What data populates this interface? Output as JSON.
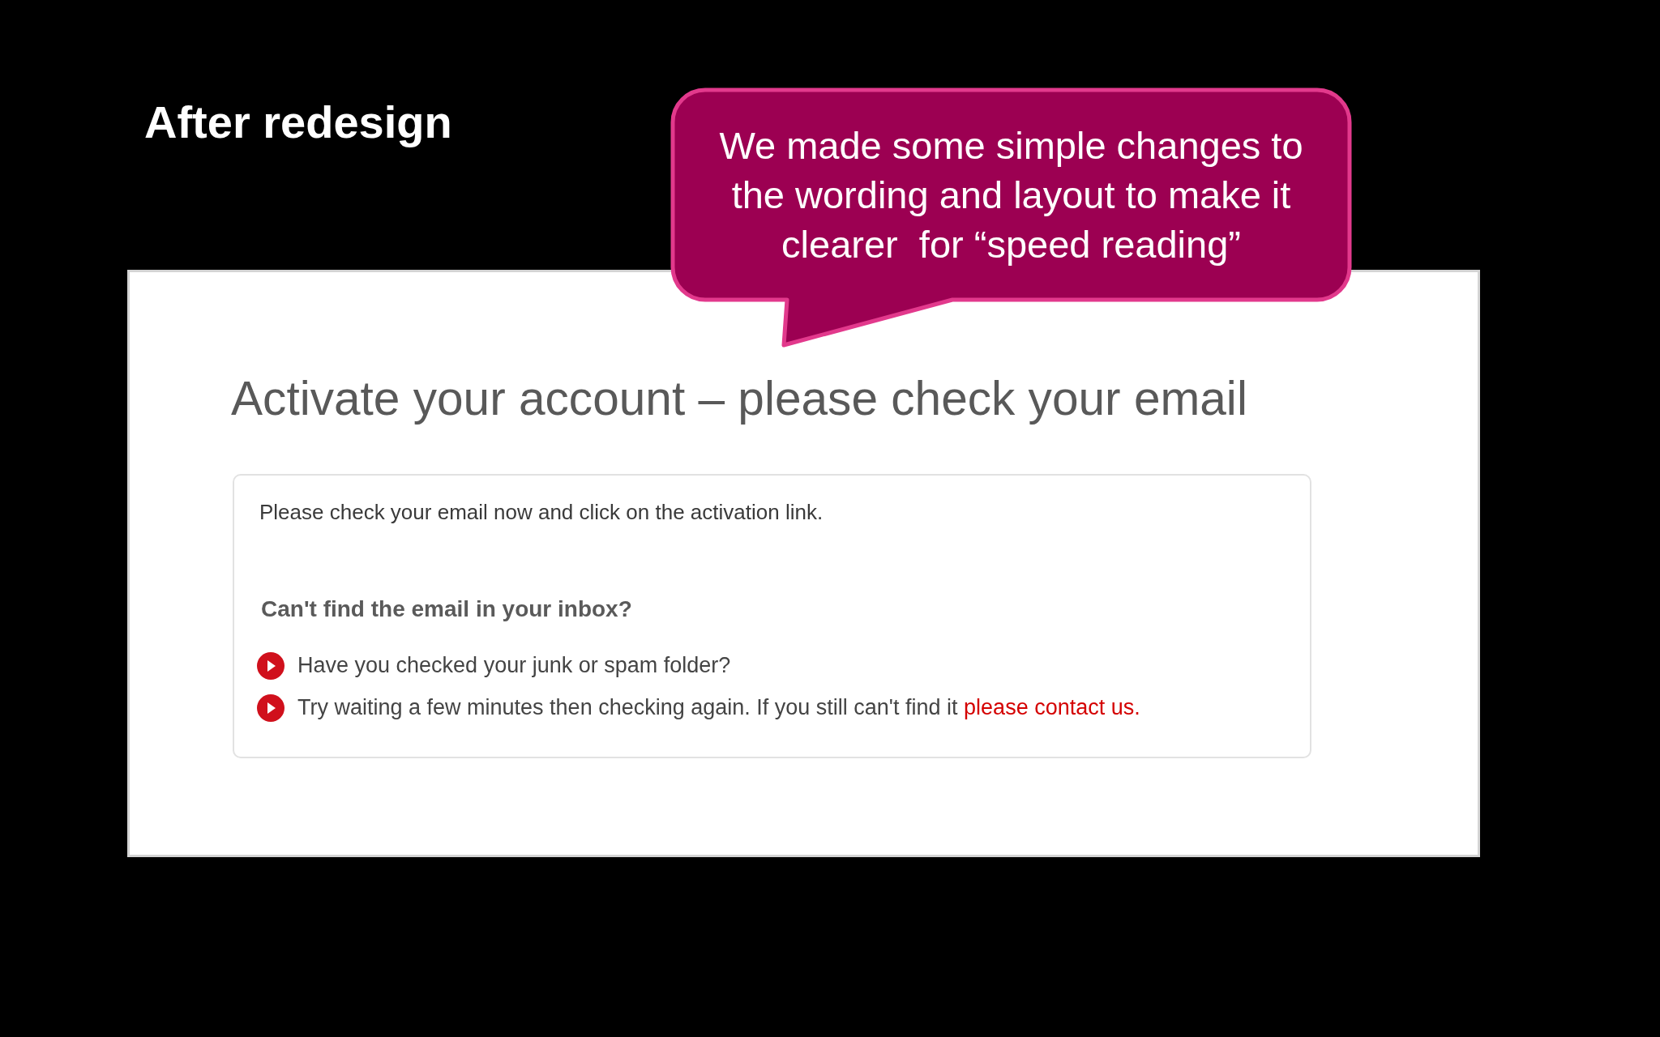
{
  "slide": {
    "title": "After redesign"
  },
  "callout": {
    "lines": [
      "We made some simple changes to",
      "the wording and layout to make it",
      "clearer  for “speed reading”"
    ]
  },
  "page": {
    "heading": "Activate your account – please check your email",
    "message": {
      "intro": "Please check your email now and click on the activation link.",
      "subheading": "Can't find the email in your inbox?",
      "tips": [
        {
          "text": "Have you checked your junk or spam folder?"
        },
        {
          "text": "Try waiting a few minutes then checking again. If you still can't find it",
          "link": "please contact us."
        }
      ]
    }
  }
}
